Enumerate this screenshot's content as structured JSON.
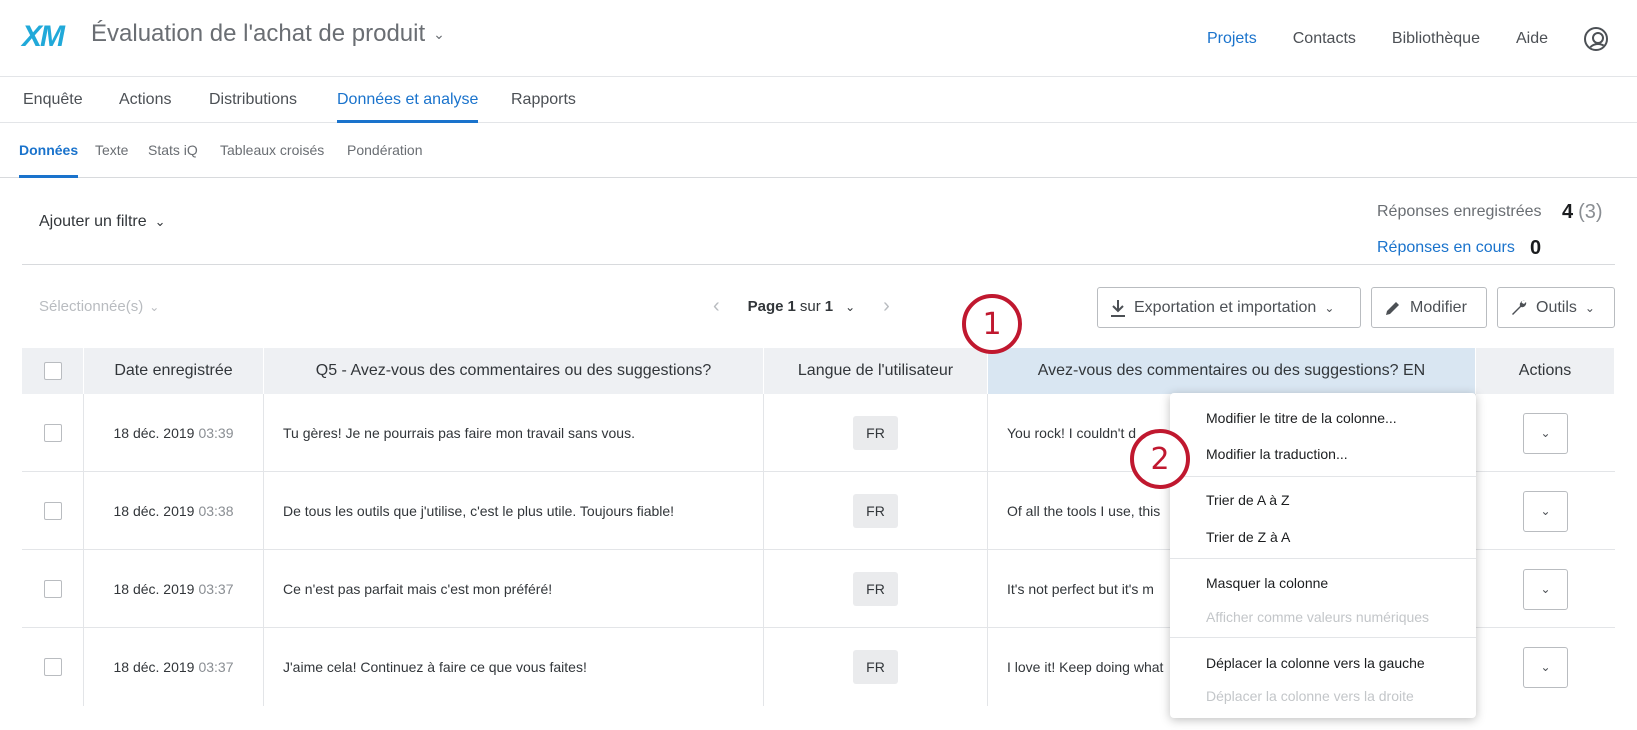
{
  "header": {
    "logo": "XM",
    "project_title": "Évaluation de l'achat de produit",
    "nav": [
      "Projets",
      "Contacts",
      "Bibliothèque",
      "Aide"
    ],
    "active_nav": "Projets"
  },
  "main_tabs": [
    "Enquête",
    "Actions",
    "Distributions",
    "Données et analyse",
    "Rapports"
  ],
  "active_main_tab": "Données et analyse",
  "sub_tabs": [
    "Données",
    "Texte",
    "Stats iQ",
    "Tableaux croisés",
    "Pondération"
  ],
  "active_sub_tab": "Données",
  "filter": {
    "label": "Ajouter un filtre"
  },
  "stats": {
    "recorded_label": "Réponses enregistrées",
    "recorded_value": "4",
    "recorded_sub": "(3)",
    "in_progress_label": "Réponses en cours",
    "in_progress_value": "0"
  },
  "toolbar": {
    "selected_label": "Sélectionnée(s)",
    "page_word": "Page",
    "page_current": "1",
    "page_of": "sur",
    "page_total": "1",
    "export_label": "Exportation et importation",
    "edit_label": "Modifier",
    "tools_label": "Outils"
  },
  "table": {
    "columns": [
      "",
      "Date enregistrée",
      "Q5 - Avez-vous des commentaires ou des suggestions?",
      "Langue de l'utilisateur",
      "Avez-vous des commentaires ou des suggestions? EN",
      "Actions"
    ],
    "rows": [
      {
        "date": "18 déc. 2019",
        "time": "03:39",
        "q5": "Tu gères! Je ne pourrais pas faire mon travail sans vous.",
        "lang": "FR",
        "en": "You rock! I couldn't d"
      },
      {
        "date": "18 déc. 2019",
        "time": "03:38",
        "q5": "De tous les outils que j'utilise, c'est le plus utile. Toujours fiable!",
        "lang": "FR",
        "en": "Of all the tools I use, this"
      },
      {
        "date": "18 déc. 2019",
        "time": "03:37",
        "q5": "Ce n'est pas parfait mais c'est mon préféré!",
        "lang": "FR",
        "en": "It's not perfect but it's m"
      },
      {
        "date": "18 déc. 2019",
        "time": "03:37",
        "q5": "J'aime cela! Continuez à faire ce que vous faites!",
        "lang": "FR",
        "en": "I love it! Keep doing what"
      }
    ]
  },
  "context_menu": {
    "items": [
      {
        "label": "Modifier le titre de la colonne...",
        "disabled": false
      },
      {
        "label": "Modifier la traduction...",
        "disabled": false
      },
      {
        "label": "Trier de A à Z",
        "disabled": false
      },
      {
        "label": "Trier de Z à A",
        "disabled": false
      },
      {
        "label": "Masquer la colonne",
        "disabled": false
      },
      {
        "label": "Afficher comme valeurs numériques",
        "disabled": true
      },
      {
        "label": "Déplacer la colonne vers la gauche",
        "disabled": false
      },
      {
        "label": "Déplacer la colonne vers la droite",
        "disabled": true
      }
    ]
  },
  "callouts": [
    "1",
    "2"
  ],
  "colors": {
    "accent": "#1a73cc",
    "callout": "#c0182f",
    "highlight_column": "#d9e6f2"
  }
}
